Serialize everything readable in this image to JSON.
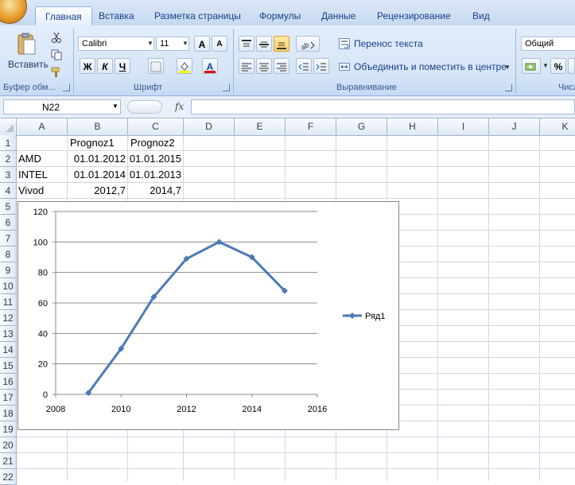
{
  "ribbon": {
    "tabs": [
      "Главная",
      "Вставка",
      "Разметка страницы",
      "Формулы",
      "Данные",
      "Рецензирование",
      "Вид"
    ],
    "active_tab": "Главная",
    "clipboard": {
      "paste_label": "Вставить",
      "group_label": "Буфер обм..."
    },
    "font": {
      "name": "Calibri",
      "size": "11",
      "bold": "Ж",
      "italic": "К",
      "underline": "Ч",
      "group_label": "Шрифт",
      "grow": "A",
      "shrink": "A",
      "color_letter": "A"
    },
    "alignment": {
      "wrap_text": "Перенос текста",
      "merge_center": "Объединить и поместить в центре",
      "group_label": "Выравнивание"
    },
    "number": {
      "format": "Общий",
      "percent": "%",
      "group_label": "Число"
    }
  },
  "formula_bar": {
    "name_box": "N22",
    "fx": "fx",
    "value": ""
  },
  "grid": {
    "columns": [
      "A",
      "B",
      "C",
      "D",
      "E",
      "F",
      "G",
      "H",
      "I",
      "J",
      "K"
    ],
    "rows": [
      "1",
      "2",
      "3",
      "4",
      "5",
      "6",
      "7",
      "8",
      "9",
      "10",
      "11",
      "12",
      "13",
      "14",
      "15",
      "16",
      "17",
      "18",
      "19",
      "20",
      "21",
      "22"
    ],
    "cells": {
      "B1": "Prognoz1",
      "C1": "Prognoz2",
      "A2": "AMD",
      "B2": "01.01.2012",
      "C2": "01.01.2015",
      "A3": "INTEL",
      "B3": "01.01.2014",
      "C3": "01.01.2013",
      "A4": "Vivod",
      "B4": "2012,7",
      "C4": "2014,7"
    }
  },
  "chart_data": {
    "type": "line",
    "x": [
      2009,
      2010,
      2011,
      2012,
      2013,
      2014,
      2015
    ],
    "series": [
      {
        "name": "Ряд1",
        "values": [
          1,
          30,
          64,
          89,
          100,
          90,
          68
        ],
        "color": "#4a7ab8"
      }
    ],
    "xlim": [
      2008,
      2016
    ],
    "ylim": [
      0,
      120
    ],
    "xticks": [
      2008,
      2010,
      2012,
      2014,
      2016
    ],
    "yticks": [
      0,
      20,
      40,
      60,
      80,
      100,
      120
    ],
    "grid": "horizontal",
    "legend": "right",
    "title": "",
    "xlabel": "",
    "ylabel": ""
  }
}
